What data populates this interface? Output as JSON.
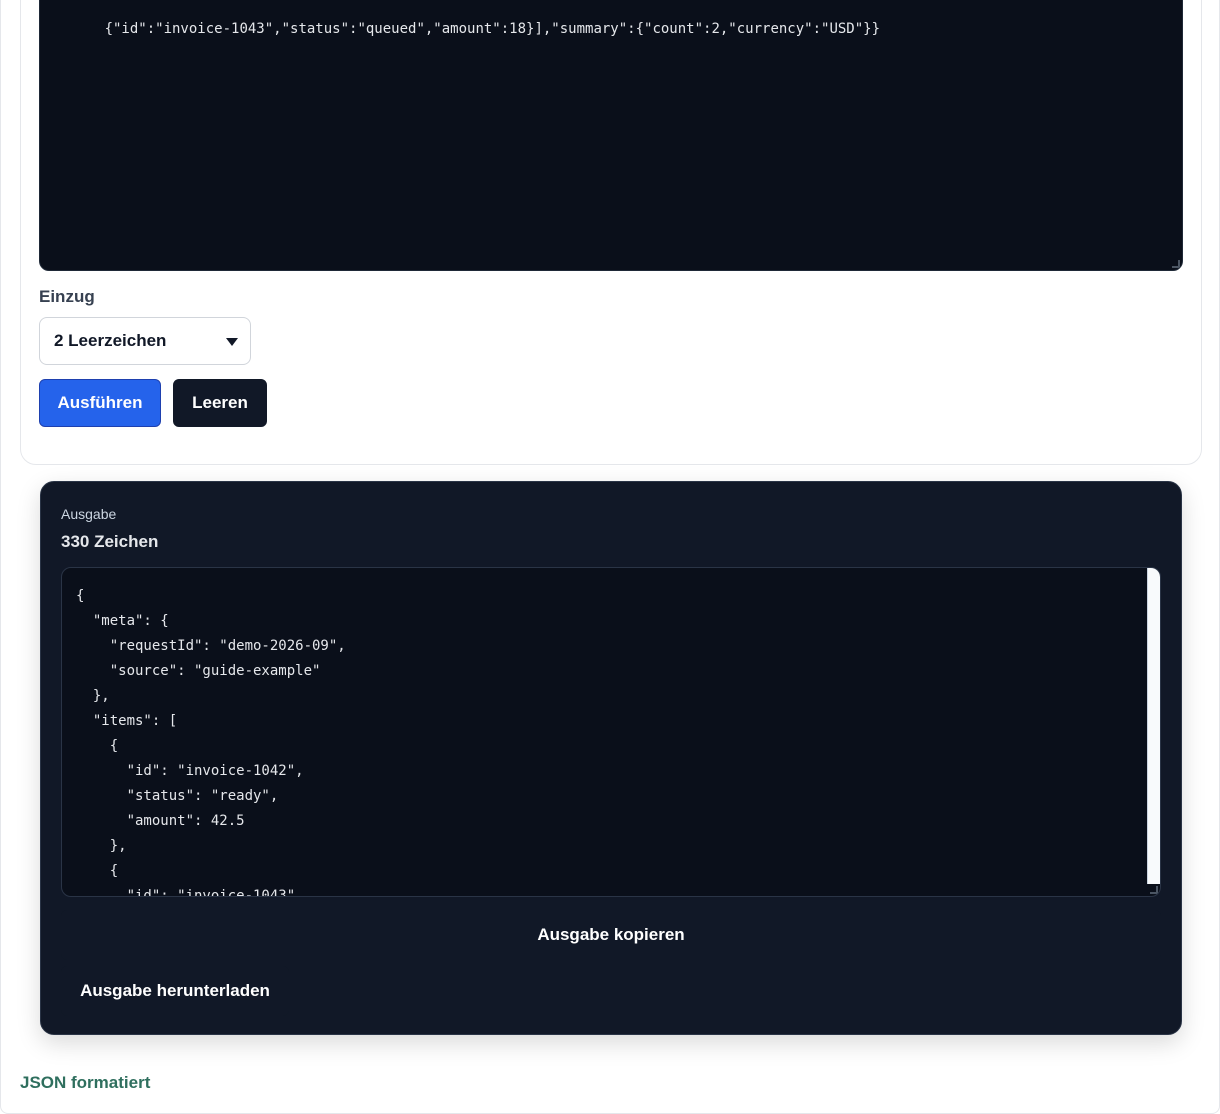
{
  "input": {
    "text": "{\"id\":\"invoice-1043\",\"status\":\"queued\",\"amount\":18}],\"summary\":{\"count\":2,\"currency\":\"USD\"}}"
  },
  "indent": {
    "label": "Einzug",
    "selected": "2 Leerzeichen"
  },
  "actions": {
    "run_label": "Ausführen",
    "clear_label": "Leeren"
  },
  "output": {
    "label": "Ausgabe",
    "count": "330 Zeichen",
    "text": "{\n  \"meta\": {\n    \"requestId\": \"demo-2026-09\",\n    \"source\": \"guide-example\"\n  },\n  \"items\": [\n    {\n      \"id\": \"invoice-1042\",\n      \"status\": \"ready\",\n      \"amount\": 42.5\n    },\n    {\n      \"id\": \"invoice-1043\",",
    "copy_label": "Ausgabe kopieren",
    "download_label": "Ausgabe herunterladen"
  },
  "status": {
    "text": "JSON formatiert",
    "color": "#2f6f5e"
  },
  "colors": {
    "primary": "#2563eb",
    "dark": "#111827",
    "editor_bg": "#0a0f1a"
  }
}
